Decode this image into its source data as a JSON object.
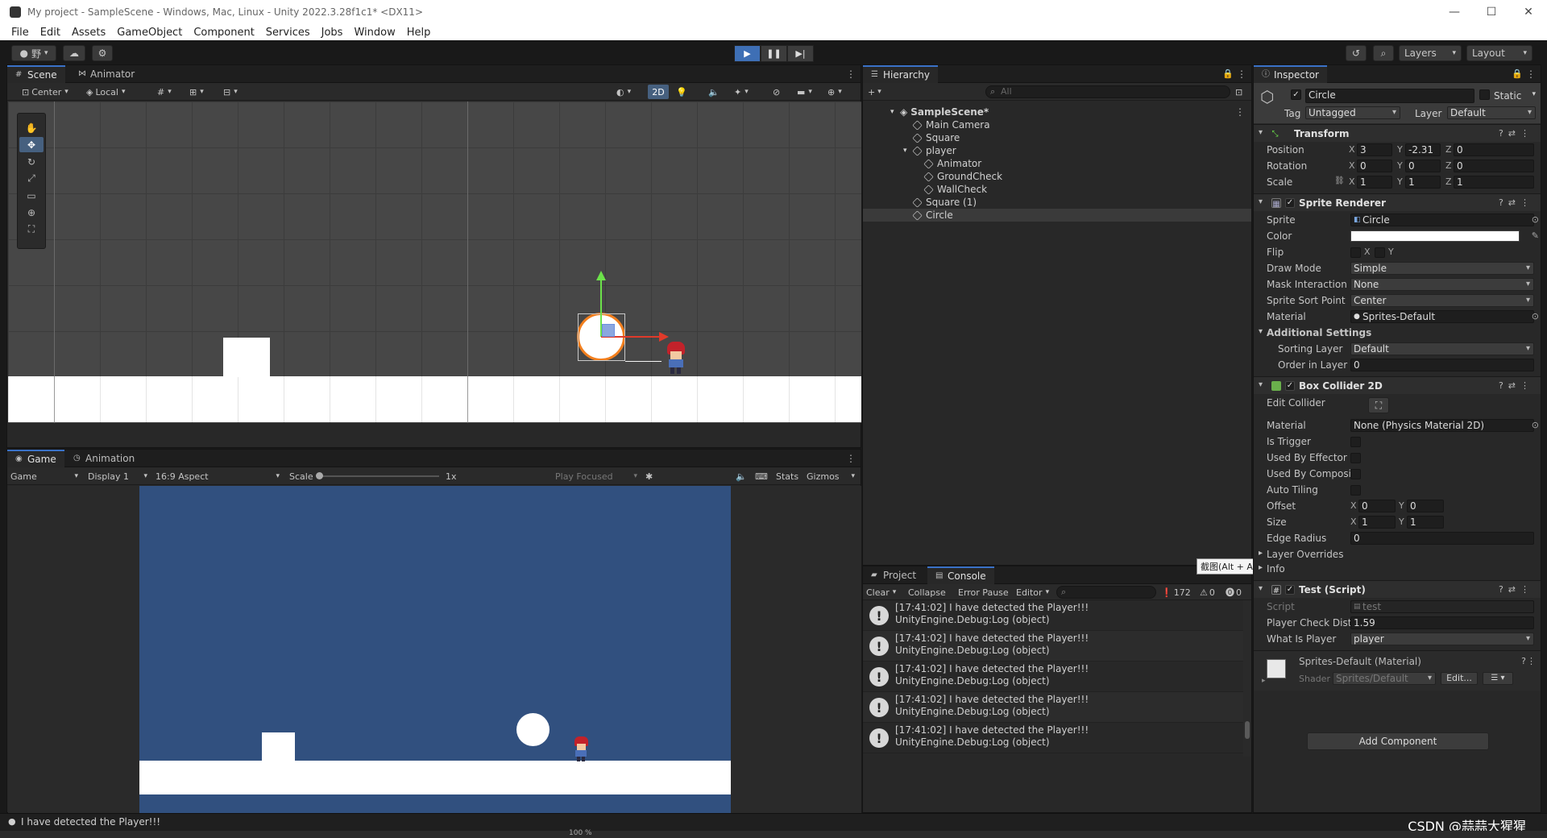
{
  "window": {
    "title": "My project - SampleScene - Windows, Mac, Linux - Unity 2022.3.28f1c1* <DX11>",
    "controls": [
      "—",
      "☐",
      "✕"
    ]
  },
  "menu": [
    "File",
    "Edit",
    "Assets",
    "GameObject",
    "Component",
    "Services",
    "Jobs",
    "Window",
    "Help"
  ],
  "toolbar": {
    "account_label": "野",
    "layers_label": "Layers",
    "layout_label": "Layout"
  },
  "scene_panel": {
    "tabs": [
      "Scene",
      "Animator"
    ],
    "pivot_mode": "Center",
    "pivot_rotation": "Local",
    "mode_2d": "2D"
  },
  "game_panel": {
    "tabs": [
      "Game",
      "Animation"
    ],
    "view_mode": "Game",
    "display": "Display 1",
    "aspect": "16:9 Aspect",
    "scale_label": "Scale",
    "scale_value": "1x",
    "play_focused": "Play Focused",
    "stats": "Stats",
    "gizmos": "Gizmos"
  },
  "hierarchy": {
    "tab": "Hierarchy",
    "search_placeholder": "All",
    "scene_name": "SampleScene*",
    "items": [
      {
        "name": "Main Camera",
        "depth": 1
      },
      {
        "name": "Square",
        "depth": 1
      },
      {
        "name": "player",
        "depth": 1
      },
      {
        "name": "Animator",
        "depth": 2
      },
      {
        "name": "GroundCheck",
        "depth": 2
      },
      {
        "name": "WallCheck",
        "depth": 2
      },
      {
        "name": "Square (1)",
        "depth": 1
      },
      {
        "name": "Circle",
        "depth": 1
      }
    ]
  },
  "console": {
    "tabs": [
      "Project",
      "Console"
    ],
    "buttons": {
      "clear": "Clear",
      "collapse": "Collapse",
      "error_pause": "Error Pause",
      "editor": "Editor"
    },
    "counts": {
      "log": "172",
      "warn": "0",
      "error": "0"
    },
    "tooltip": "截图(Alt + A)",
    "entries": [
      {
        "line1": "[17:41:02] I have detected the Player!!!",
        "line2": "UnityEngine.Debug:Log (object)"
      },
      {
        "line1": "[17:41:02] I have detected the Player!!!",
        "line2": "UnityEngine.Debug:Log (object)"
      },
      {
        "line1": "[17:41:02] I have detected the Player!!!",
        "line2": "UnityEngine.Debug:Log (object)"
      },
      {
        "line1": "[17:41:02] I have detected the Player!!!",
        "line2": "UnityEngine.Debug:Log (object)"
      },
      {
        "line1": "[17:41:02] I have detected the Player!!!",
        "line2": "UnityEngine.Debug:Log (object)"
      }
    ]
  },
  "inspector": {
    "tab": "Inspector",
    "object_name": "Circle",
    "static_label": "Static",
    "tag_label": "Tag",
    "tag_value": "Untagged",
    "layer_label": "Layer",
    "layer_value": "Default",
    "transform": {
      "title": "Transform",
      "position": {
        "label": "Position",
        "x": "3",
        "y": "-2.31",
        "z": "0"
      },
      "rotation": {
        "label": "Rotation",
        "x": "0",
        "y": "0",
        "z": "0"
      },
      "scale": {
        "label": "Scale",
        "x": "1",
        "y": "1",
        "z": "1"
      }
    },
    "sprite_renderer": {
      "title": "Sprite Renderer",
      "sprite_label": "Sprite",
      "sprite_value": "Circle",
      "color_label": "Color",
      "flip_label": "Flip",
      "flip_x": "X",
      "flip_y": "Y",
      "draw_mode_label": "Draw Mode",
      "draw_mode_value": "Simple",
      "mask_label": "Mask Interaction",
      "mask_value": "None",
      "sort_point_label": "Sprite Sort Point",
      "sort_point_value": "Center",
      "material_label": "Material",
      "material_value": "Sprites-Default",
      "additional_label": "Additional Settings",
      "sorting_layer_label": "Sorting Layer",
      "sorting_layer_value": "Default",
      "order_label": "Order in Layer",
      "order_value": "0"
    },
    "box_collider": {
      "title": "Box Collider 2D",
      "edit_collider_label": "Edit Collider",
      "material_label": "Material",
      "material_value": "None (Physics Material 2D)",
      "is_trigger": "Is Trigger",
      "used_by_effector": "Used By Effector",
      "used_by_composite": "Used By Composite",
      "auto_tiling": "Auto Tiling",
      "offset_label": "Offset",
      "offset_x": "0",
      "offset_y": "0",
      "size_label": "Size",
      "size_x": "1",
      "size_y": "1",
      "edge_radius_label": "Edge Radius",
      "edge_radius_value": "0",
      "layer_overrides": "Layer Overrides",
      "info": "Info"
    },
    "test_script": {
      "title": "Test (Script)",
      "script_label": "Script",
      "script_value": "test",
      "distance_label": "Player Check Distanc",
      "distance_value": "1.59",
      "what_label": "What Is Player",
      "what_value": "player"
    },
    "material": {
      "title": "Sprites-Default (Material)",
      "shader_label": "Shader",
      "shader_value": "Sprites/Default",
      "edit_label": "Edit..."
    },
    "add_component": "Add Component"
  },
  "status": {
    "message": "I have detected the Player!!!",
    "watermark": "CSDN @蒜蒜大猩猩",
    "taskbar_zoom": "100 %"
  },
  "colors": {
    "game_bg": "#31507f",
    "scene_bg": "#474747",
    "selection_orange": "#f27f1e",
    "accent_blue": "#3e6fb5"
  }
}
